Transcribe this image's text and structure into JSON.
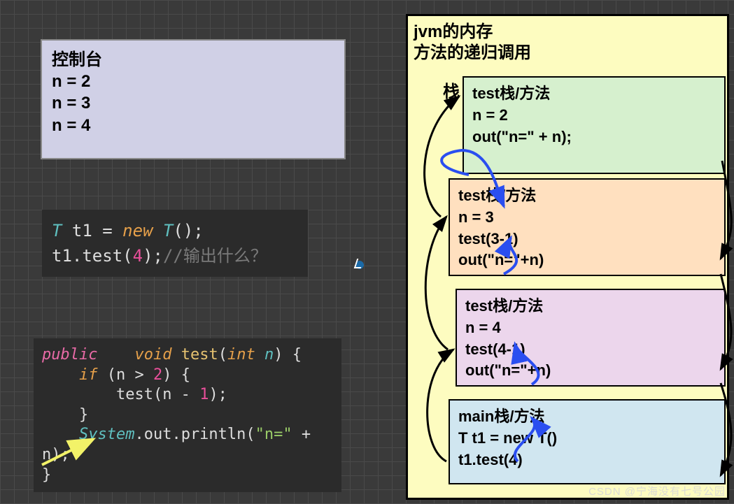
{
  "console": {
    "title": "控制台",
    "lines": [
      "n = 2",
      "n = 3",
      "n = 4"
    ]
  },
  "code_call": {
    "type": "T",
    "var": "t1",
    "new_kw": "new",
    "ctor": "T",
    "call": "t1.test",
    "arg": "4",
    "comment": "//输出什么？"
  },
  "code_def": {
    "public": "public",
    "void": "void",
    "fn": "test",
    "int": "int",
    "param": "n",
    "if": "if",
    "cond_l": "(n > ",
    "cond_n": "2",
    "cond_r": ") {",
    "recurse": "test(n - ",
    "recurse_n": "1",
    "recurse_r": ");",
    "sys": "System",
    "out": ".out.println(",
    "str": "\"n=\"",
    "plus": " + n);"
  },
  "jvm": {
    "title1": "jvm的内存",
    "title2": "方法的递归调用",
    "stack_label": "栈",
    "frames": {
      "f1": {
        "title": "test栈/方法",
        "l1": "n = 2",
        "l2": "out(\"n=\" + n);"
      },
      "f2": {
        "title": "test栈/方法",
        "l1": "n = 3",
        "l2": "test(3-1)",
        "l3": "out(\"n=\"+n)"
      },
      "f3": {
        "title": "test栈/方法",
        "l1": "n = 4",
        "l2": "test(4-1)",
        "l3": "out(\"n=\"+n)"
      },
      "f4": {
        "title": "main栈/方法",
        "l1": "T t1 = new T()",
        "l2": "t1.test(4)"
      }
    }
  },
  "watermark": "CSDN @宁海没有七号公园"
}
